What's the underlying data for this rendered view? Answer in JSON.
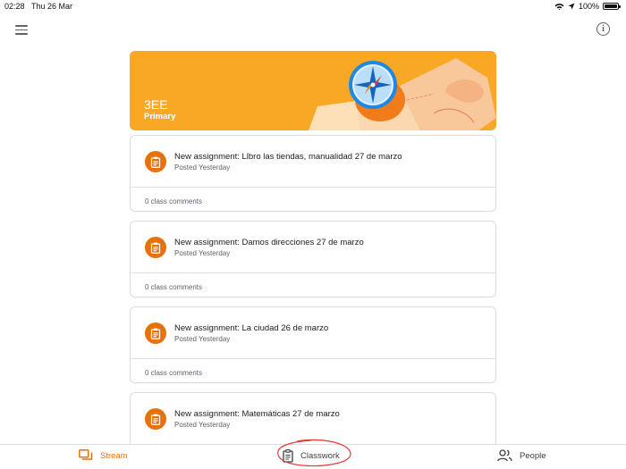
{
  "status_bar": {
    "time": "02:28",
    "date": "Thu 26 Mar",
    "battery": "100%"
  },
  "colors": {
    "accent": "#e8710a",
    "banner": "#f9a825",
    "annotation": "#e53935"
  },
  "banner": {
    "class_name": "3EE",
    "section": "Primary"
  },
  "posts": [
    {
      "title": "New assignment: Llbro las tiendas, manualidad 27 de marzo",
      "meta": "Posted Yesterday",
      "comments": "0 class comments",
      "icon": "assignment-icon"
    },
    {
      "title": "New assignment: Damos direcciones 27 de marzo",
      "meta": "Posted Yesterday",
      "comments": "0 class comments",
      "icon": "assignment-icon"
    },
    {
      "title": "New assignment: La ciudad 26 de marzo",
      "meta": "Posted Yesterday",
      "comments": "0 class comments",
      "icon": "assignment-icon"
    },
    {
      "title": "New assignment: Matemáticas 27 de marzo",
      "meta": "Posted Yesterday",
      "comments": "",
      "icon": "assignment-icon"
    }
  ],
  "bottom_nav": {
    "stream": "Stream",
    "classwork": "Classwork",
    "people": "People",
    "active": "stream"
  }
}
